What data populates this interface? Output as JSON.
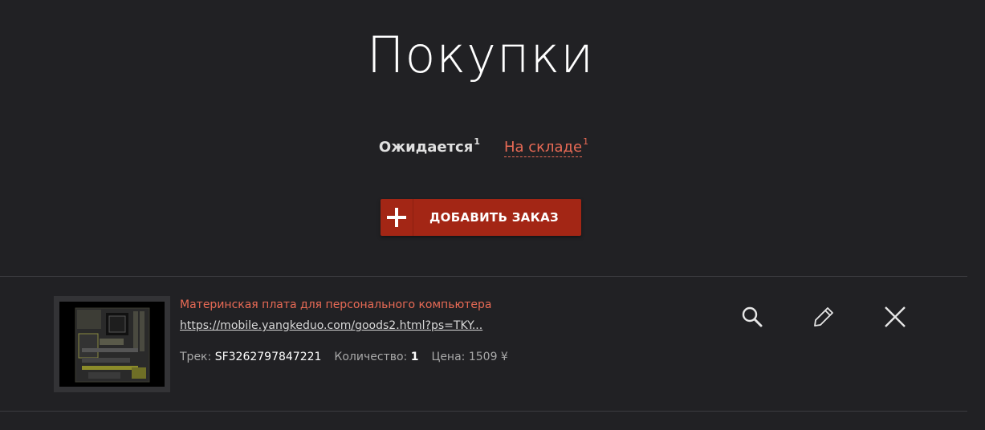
{
  "page": {
    "title": "Покупки"
  },
  "tabs": [
    {
      "label": "Ожидается",
      "count": "1",
      "active": true
    },
    {
      "label": "На складе",
      "count": "1",
      "active": false
    }
  ],
  "toolbar": {
    "add_order_label": "ДОБАВИТЬ ЗАКАЗ"
  },
  "orders": [
    {
      "name": "Материнская плата для персонального компьютера",
      "url": "https://mobile.yangkeduo.com/goods2.html?ps=TKY...",
      "track_label": "Трек:",
      "track_value": "SF3262797847221",
      "qty_label": "Количество:",
      "qty_value": "1",
      "price_label": "Цена:",
      "price_value": "1509 ¥"
    }
  ],
  "colors": {
    "background": "#212124",
    "accent": "#e86a55",
    "button": "#a32615"
  },
  "icons": {
    "add": "plus-icon",
    "view": "search-icon",
    "edit": "pencil-icon",
    "delete": "close-icon"
  }
}
